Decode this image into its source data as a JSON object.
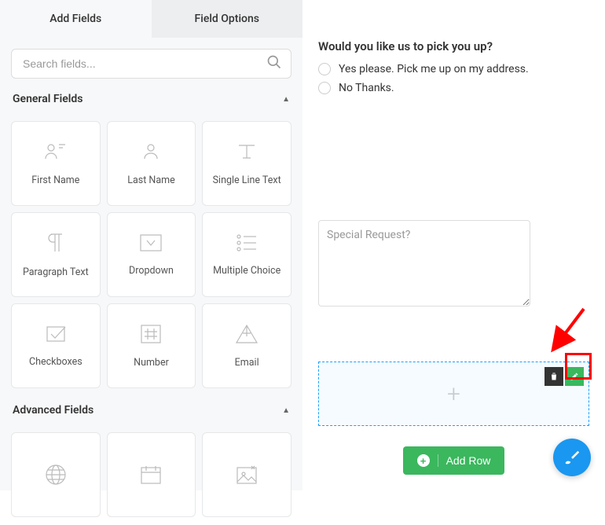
{
  "tabs": {
    "add_fields": "Add Fields",
    "field_options": "Field Options"
  },
  "search": {
    "placeholder": "Search fields..."
  },
  "sections": {
    "general": {
      "title": "General Fields"
    },
    "advanced": {
      "title": "Advanced Fields"
    }
  },
  "general_fields": [
    {
      "label": "First Name"
    },
    {
      "label": "Last Name"
    },
    {
      "label": "Single Line Text"
    },
    {
      "label": "Paragraph Text"
    },
    {
      "label": "Dropdown"
    },
    {
      "label": "Multiple Choice"
    },
    {
      "label": "Checkboxes"
    },
    {
      "label": "Number"
    },
    {
      "label": "Email"
    }
  ],
  "form": {
    "question": "Would you like us to pick you up?",
    "options": [
      "Yes please. Pick me up on my address.",
      "No Thanks."
    ],
    "textarea_placeholder": "Special Request?"
  },
  "buttons": {
    "add_row": "Add Row"
  }
}
